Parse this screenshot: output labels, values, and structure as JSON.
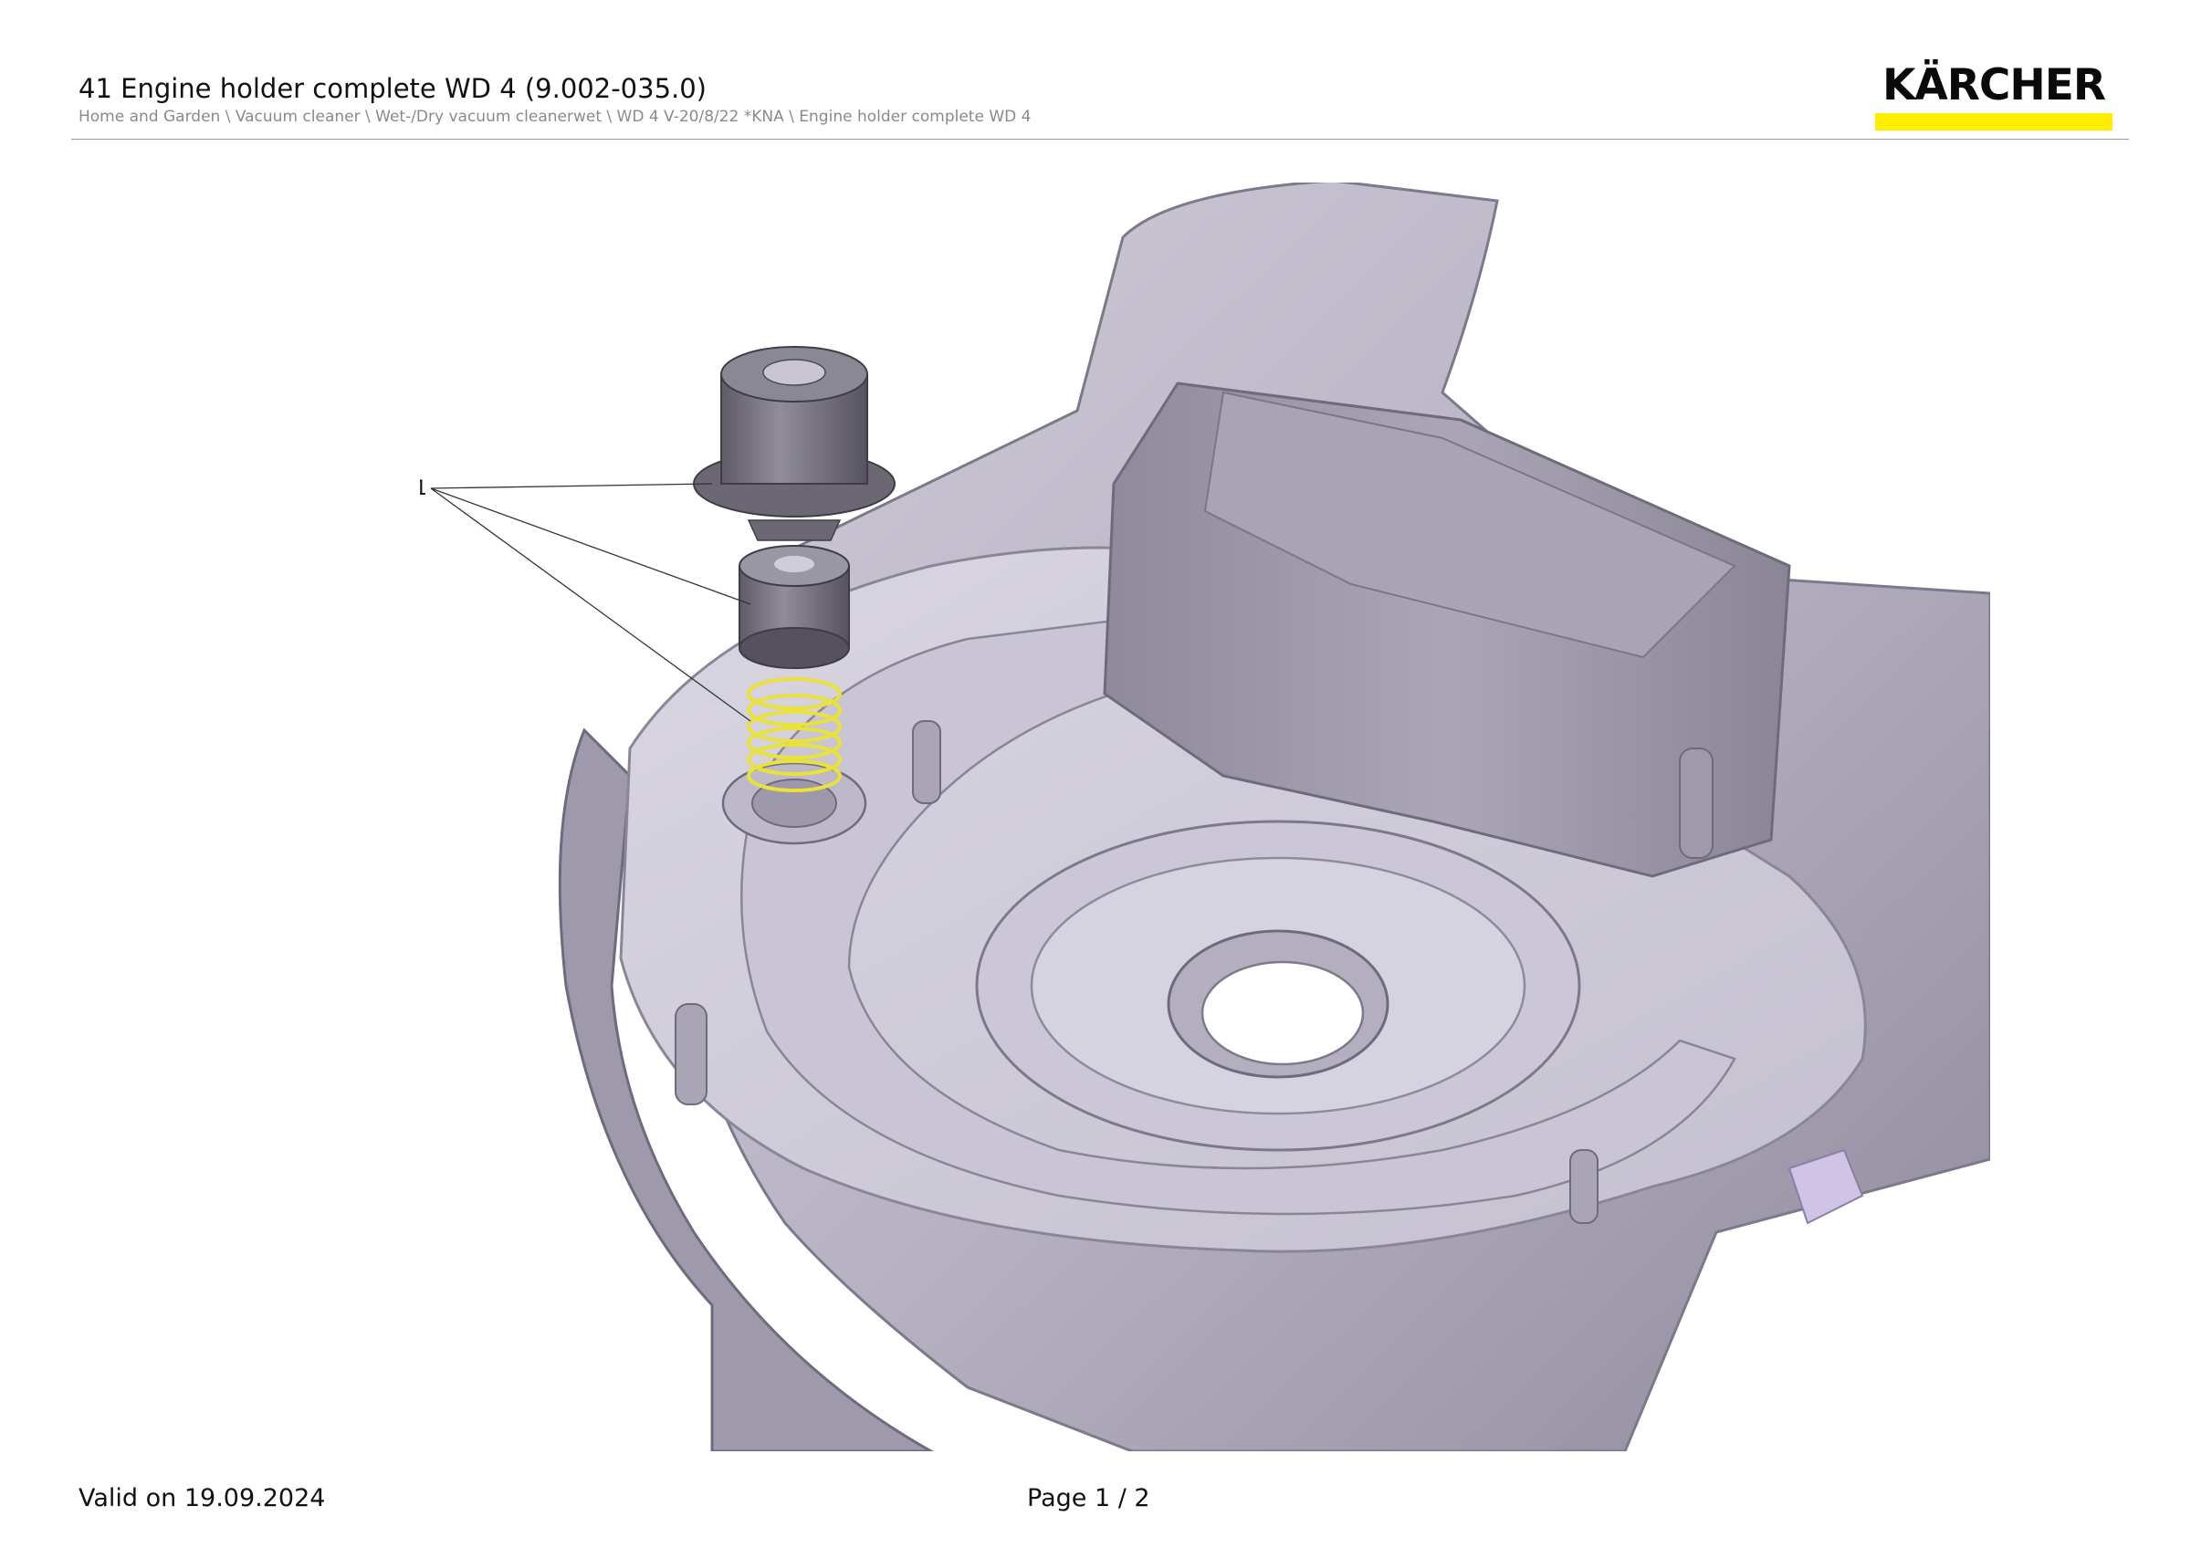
{
  "header": {
    "title": "41 Engine holder complete WD 4 (9.002-035.0)",
    "breadcrumb": "Home and Garden \\ Vacuum cleaner \\ Wet-/Dry vacuum cleanerwet \\ WD 4 V-20/8/22 *KNA \\ Engine holder complete WD 4"
  },
  "logo": {
    "text": "KÄRCHER",
    "accent_color": "#ffed00"
  },
  "drawing": {
    "callout_label": "1",
    "spring_color": "#e8e23a",
    "housing_color": "#b9b5c4"
  },
  "footer": {
    "valid_text": "Valid on 19.09.2024",
    "page_text": "Page 1 / 2"
  }
}
